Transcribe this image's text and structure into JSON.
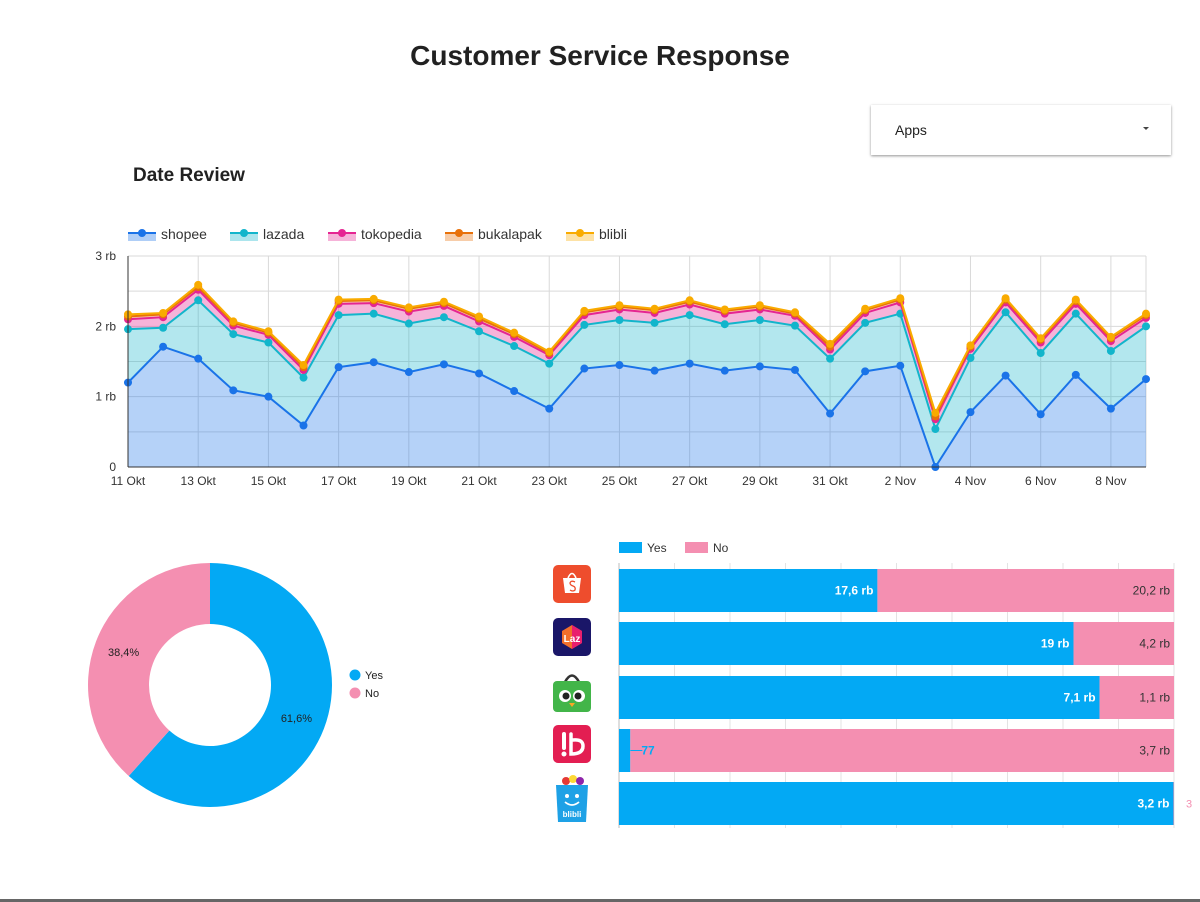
{
  "page": {
    "title": "Customer Service Response"
  },
  "filter": {
    "label": "Apps"
  },
  "section": {
    "date_review_title": "Date Review"
  },
  "colors": {
    "shopee": "#1a73e8",
    "lazada": "#12b5cb",
    "tokopedia": "#e52592",
    "bukalapak": "#e8710a",
    "blibli": "#f9ab00",
    "yes": "#03a9f4",
    "no": "#f48fb1"
  },
  "chart_data": [
    {
      "type": "area",
      "title": "",
      "stacked": true,
      "legend_position": "top-left",
      "grid": true,
      "x": [
        "11 Okt",
        "12 Okt",
        "13 Okt",
        "14 Okt",
        "15 Okt",
        "16 Okt",
        "17 Okt",
        "18 Okt",
        "19 Okt",
        "20 Okt",
        "21 Okt",
        "22 Okt",
        "23 Okt",
        "24 Okt",
        "25 Okt",
        "26 Okt",
        "27 Okt",
        "28 Okt",
        "29 Okt",
        "30 Okt",
        "31 Okt",
        "1 Nov",
        "2 Nov",
        "3 Nov",
        "4 Nov",
        "5 Nov",
        "6 Nov",
        "7 Nov",
        "8 Nov",
        "9 Nov"
      ],
      "x_tick_labels": [
        "11 Okt",
        "13 Okt",
        "15 Okt",
        "17 Okt",
        "19 Okt",
        "21 Okt",
        "23 Okt",
        "25 Okt",
        "27 Okt",
        "29 Okt",
        "31 Okt",
        "2 Nov",
        "4 Nov",
        "6 Nov",
        "8 Nov"
      ],
      "y_ticks": [
        0,
        1000,
        2000,
        3000
      ],
      "y_tick_labels": [
        "0",
        "1 rb",
        "2 rb",
        "3 rb"
      ],
      "ylim": [
        0,
        3000
      ],
      "series": [
        {
          "name": "shopee",
          "values": [
            1200,
            1710,
            1540,
            1090,
            1000,
            590,
            1420,
            1490,
            1350,
            1460,
            1330,
            1080,
            830,
            1400,
            1450,
            1370,
            1470,
            1370,
            1430,
            1380,
            760,
            1360,
            1440,
            0,
            780,
            1300,
            750,
            1310,
            830,
            1250
          ]
        },
        {
          "name": "lazada",
          "values": [
            760,
            270,
            830,
            800,
            770,
            680,
            740,
            690,
            690,
            670,
            600,
            640,
            640,
            620,
            640,
            680,
            690,
            660,
            660,
            630,
            780,
            690,
            740,
            540,
            770,
            900,
            870,
            870,
            820,
            750
          ]
        },
        {
          "name": "tokopedia",
          "values": [
            140,
            150,
            150,
            120,
            110,
            110,
            160,
            150,
            170,
            160,
            140,
            130,
            120,
            140,
            150,
            140,
            150,
            150,
            150,
            140,
            130,
            140,
            160,
            140,
            130,
            140,
            150,
            140,
            140,
            120
          ]
        },
        {
          "name": "bukalapak",
          "values": [
            40,
            40,
            40,
            40,
            30,
            40,
            40,
            40,
            40,
            40,
            40,
            40,
            30,
            40,
            40,
            40,
            40,
            40,
            40,
            30,
            40,
            40,
            40,
            40,
            30,
            40,
            40,
            40,
            40,
            40
          ]
        },
        {
          "name": "blibli",
          "values": [
            30,
            20,
            30,
            20,
            20,
            30,
            20,
            20,
            20,
            20,
            30,
            20,
            20,
            20,
            20,
            20,
            20,
            20,
            20,
            20,
            40,
            20,
            20,
            50,
            20,
            20,
            20,
            20,
            20,
            20
          ]
        }
      ]
    },
    {
      "type": "pie",
      "donut": true,
      "legend_position": "right",
      "categories": [
        "Yes",
        "No"
      ],
      "values": [
        61.6,
        38.4
      ],
      "labels": [
        "61,6%",
        "38,4%"
      ]
    },
    {
      "type": "bar",
      "orientation": "horizontal",
      "stacked": true,
      "legend_position": "top",
      "categories": [
        "shopee-logo",
        "lazada-logo",
        "tokopedia-logo",
        "bukalapak-logo",
        "blibli-logo"
      ],
      "series": [
        {
          "name": "Yes",
          "values": [
            17600,
            19000,
            7100,
            77,
            3200
          ],
          "labels": [
            "17,6 rb",
            "19 rb",
            "7,1 rb",
            "77",
            "3,2 rb"
          ]
        },
        {
          "name": "No",
          "values": [
            20200,
            4200,
            1100,
            3700,
            3
          ],
          "labels": [
            "20,2 rb",
            "4,2 rb",
            "1,1 rb",
            "3,7 rb",
            "3"
          ]
        }
      ]
    }
  ]
}
